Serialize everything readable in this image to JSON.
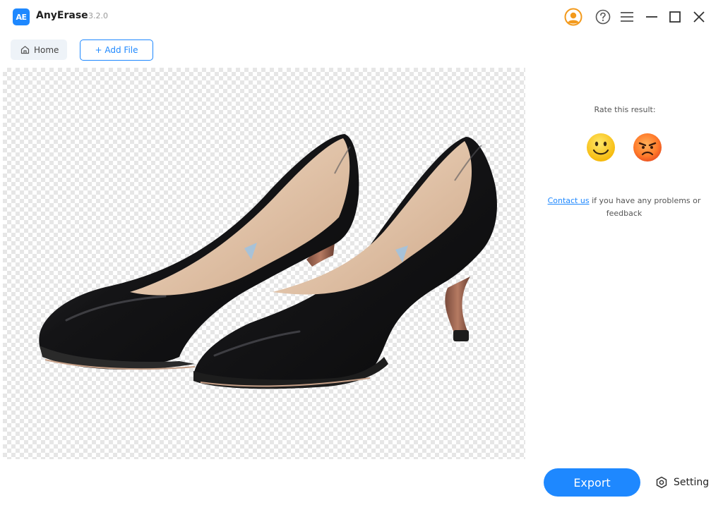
{
  "app": {
    "logo_text": "AE",
    "name": "AnyErase",
    "version": "3.2.0",
    "brand_color": "#1e88ff"
  },
  "window_controls": {
    "icons": [
      "account-icon",
      "help-icon",
      "menu-icon",
      "minimize-icon",
      "maximize-icon",
      "close-icon"
    ]
  },
  "toolbar": {
    "home_label": "Home",
    "add_file_label": "+ Add File"
  },
  "canvas": {
    "background": "transparent-checkerboard",
    "image_subject": "black-high-heel-pumps"
  },
  "rating": {
    "prompt": "Rate this result:",
    "options": [
      "smile-emoji-icon",
      "angry-emoji-icon"
    ]
  },
  "contact": {
    "link_text": "Contact us",
    "rest_text": " if you have any problems or feedback"
  },
  "footer": {
    "export_label": "Export",
    "setting_label": "Setting"
  }
}
